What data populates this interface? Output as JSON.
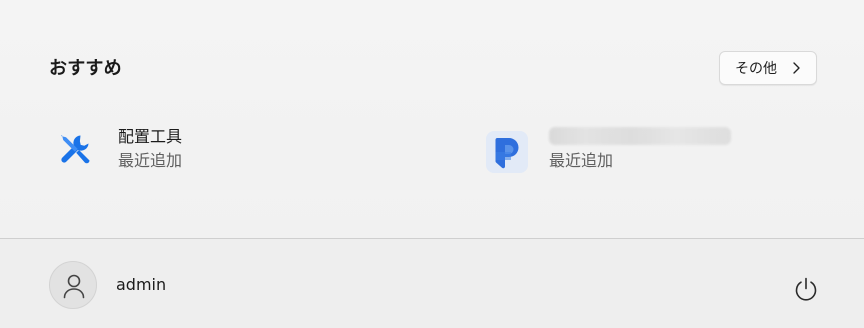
{
  "recommended": {
    "title": "おすすめ",
    "more_label": "その他",
    "items": [
      {
        "name": "配置工具",
        "subtitle": "最近追加",
        "icon": "tools-icon"
      },
      {
        "name": "",
        "subtitle": "最近追加",
        "icon": "p-app-icon"
      }
    ]
  },
  "footer": {
    "user_name": "admin",
    "avatar_icon": "person-icon",
    "power_icon": "power-icon"
  },
  "colors": {
    "tools_blue": "#1a73e8",
    "app_blue": "#2f6fdd",
    "panel_bg": "#f2f2f2",
    "footer_bg": "#eeeeee"
  }
}
